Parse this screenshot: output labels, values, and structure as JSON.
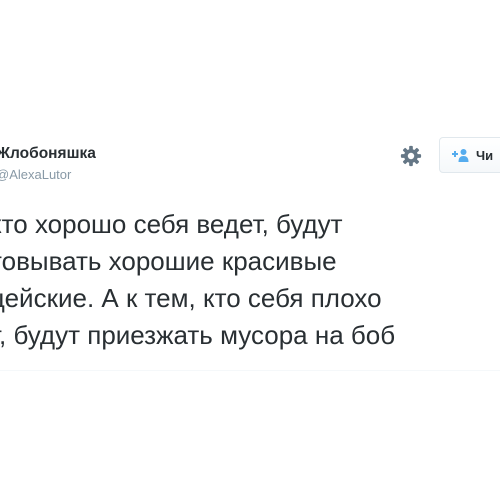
{
  "profile": {
    "display_name": "Жлобоняшка",
    "handle": "@AlexaLutor"
  },
  "actions": {
    "settings_icon": "gear-icon",
    "follow_icon": "add-user-icon",
    "follow_label": "Чи"
  },
  "tweet": {
    "lines": [
      "кто хорошо себя ведет, будут",
      "товывать хорошие красивые",
      "цейские. А к тем, кто себя плохо",
      "т, будут приезжать мусора на боб"
    ]
  },
  "colors": {
    "text": "#292f33",
    "muted": "#8899a6",
    "icon": "#657786",
    "accent": "#55acee",
    "border": "#e1e8ed"
  }
}
